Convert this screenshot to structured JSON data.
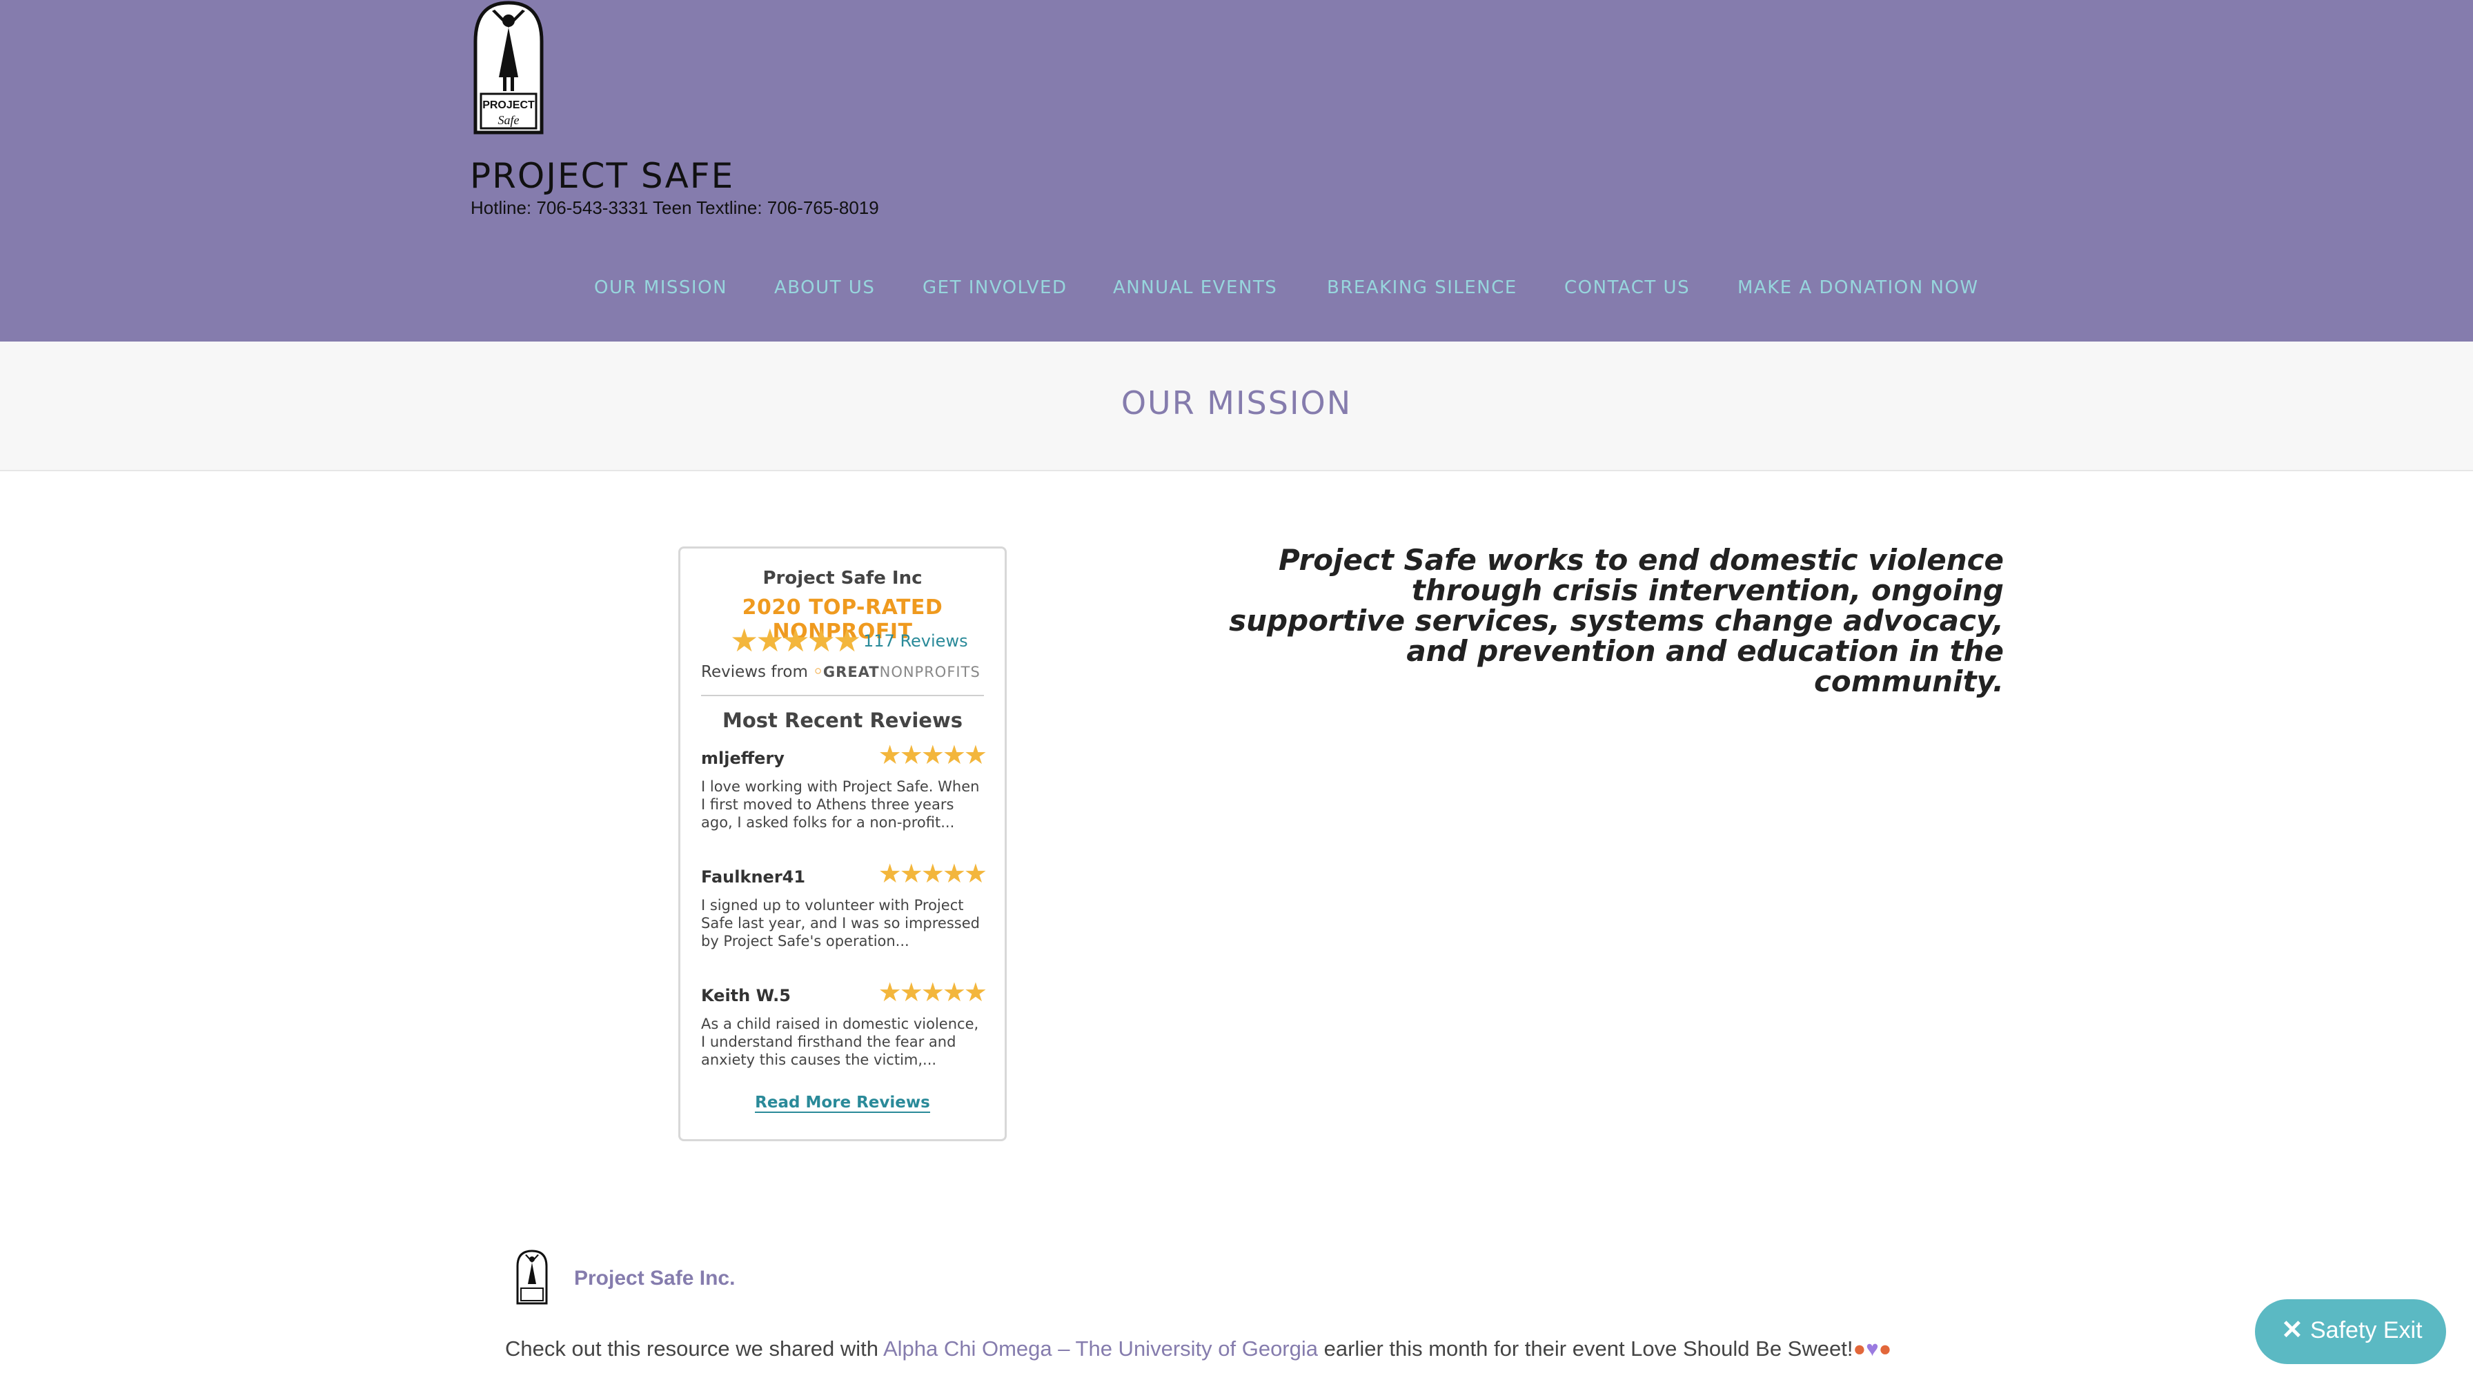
{
  "header": {
    "logo_alt": "PROJECT Safe",
    "site_title": "PROJECT SAFE",
    "tagline": "Hotline: 706-543-3331 Teen Textline: 706-765-8019"
  },
  "nav": {
    "items": [
      {
        "label": "OUR MISSION"
      },
      {
        "label": "ABOUT US"
      },
      {
        "label": "GET INVOLVED"
      },
      {
        "label": "ANNUAL EVENTS"
      },
      {
        "label": "BREAKING SILENCE"
      },
      {
        "label": "CONTACT US"
      },
      {
        "label": "MAKE A DONATION NOW"
      }
    ]
  },
  "page_title": "OUR MISSION",
  "widget": {
    "org": "Project Safe Inc",
    "rated": "2020 TOP-RATED NONPROFIT",
    "rating_stars": 5,
    "review_count": "117 Reviews",
    "reviews_from": "Reviews from",
    "gn_great": "GREAT",
    "gn_nonprofits": "NONPROFITS",
    "recent_heading": "Most Recent Reviews",
    "reviews": [
      {
        "name": "mljeffery",
        "stars": 5,
        "text": "I love working with Project Safe. When I first moved to Athens three years ago, I asked folks for a non-profit..."
      },
      {
        "name": "Faulkner41",
        "stars": 5,
        "text": "I signed up to volunteer with Project Safe last year, and I was so impressed by Project Safe's operation..."
      },
      {
        "name": "Keith W.5",
        "stars": 5,
        "text": "As a child raised in domestic violence, I understand firsthand the fear and anxiety this causes the victim,..."
      }
    ],
    "read_more": "Read More Reviews"
  },
  "mission": "Project Safe works to end domestic violence through crisis intervention, ongoing supportive services, systems change advocacy, and prevention and education in the community.",
  "post": {
    "author": "Project Safe Inc.",
    "text_before": "Check out this resource we shared with ",
    "link": "Alpha Chi Omega – The University of Georgia",
    "text_after": " earlier this month for their event Love Should Be Sweet!"
  },
  "safety_exit": {
    "label": "Safety Exit",
    "icon": "close-icon"
  },
  "colors": {
    "header_bg": "#857cad",
    "nav_text": "#97d6dd",
    "accent_orange": "#ef9a1f",
    "link_teal": "#2a8a99",
    "safety_exit_bg": "#5bb9c3"
  }
}
